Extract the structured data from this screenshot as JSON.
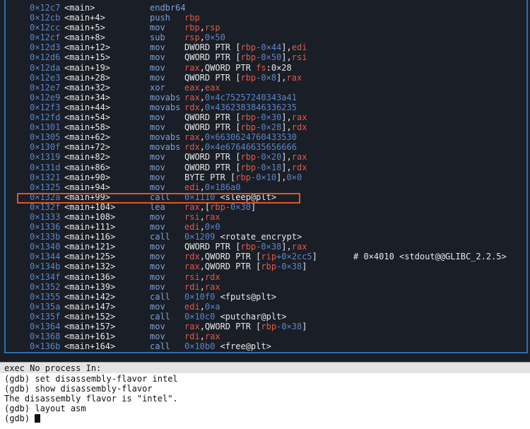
{
  "asm": {
    "rows": [
      {
        "addr": "0×12c7",
        "sym": "<main>",
        "mn": "endbr64",
        "ops": []
      },
      {
        "addr": "0×12cb",
        "sym": "<main+4>",
        "mn": "push",
        "ops": [
          {
            "t": "rbp",
            "k": "reg"
          }
        ]
      },
      {
        "addr": "0×12cc",
        "sym": "<main+5>",
        "mn": "mov",
        "ops": [
          {
            "t": "rbp",
            "k": "reg"
          },
          {
            "t": ",",
            "k": "txt"
          },
          {
            "t": "rsp",
            "k": "reg"
          }
        ]
      },
      {
        "addr": "0×12cf",
        "sym": "<main+8>",
        "mn": "sub",
        "ops": [
          {
            "t": "rsp",
            "k": "reg"
          },
          {
            "t": ",",
            "k": "txt"
          },
          {
            "t": "0×50",
            "k": "num"
          }
        ]
      },
      {
        "addr": "0×12d3",
        "sym": "<main+12>",
        "mn": "mov",
        "ops": [
          {
            "t": "DWORD PTR [",
            "k": "txt"
          },
          {
            "t": "rbp",
            "k": "reg"
          },
          {
            "t": "-0×44",
            "k": "num"
          },
          {
            "t": "],",
            "k": "txt"
          },
          {
            "t": "edi",
            "k": "reg"
          }
        ]
      },
      {
        "addr": "0×12d6",
        "sym": "<main+15>",
        "mn": "mov",
        "ops": [
          {
            "t": "QWORD PTR [",
            "k": "txt"
          },
          {
            "t": "rbp",
            "k": "reg"
          },
          {
            "t": "-0×50",
            "k": "num"
          },
          {
            "t": "],",
            "k": "txt"
          },
          {
            "t": "rsi",
            "k": "reg"
          }
        ]
      },
      {
        "addr": "0×12da",
        "sym": "<main+19>",
        "mn": "mov",
        "ops": [
          {
            "t": "rax",
            "k": "reg"
          },
          {
            "t": ",QWORD PTR ",
            "k": "txt"
          },
          {
            "t": "fs",
            "k": "reg"
          },
          {
            "t": ":0×28",
            "k": "txt"
          }
        ]
      },
      {
        "addr": "0×12e3",
        "sym": "<main+28>",
        "mn": "mov",
        "ops": [
          {
            "t": "QWORD PTR [",
            "k": "txt"
          },
          {
            "t": "rbp",
            "k": "reg"
          },
          {
            "t": "-0×8",
            "k": "num"
          },
          {
            "t": "],",
            "k": "txt"
          },
          {
            "t": "rax",
            "k": "reg"
          }
        ]
      },
      {
        "addr": "0×12e7",
        "sym": "<main+32>",
        "mn": "xor",
        "ops": [
          {
            "t": "eax",
            "k": "reg"
          },
          {
            "t": ",",
            "k": "txt"
          },
          {
            "t": "eax",
            "k": "reg"
          }
        ]
      },
      {
        "addr": "0×12e9",
        "sym": "<main+34>",
        "mn": "movabs",
        "ops": [
          {
            "t": "rax",
            "k": "reg"
          },
          {
            "t": ",",
            "k": "txt"
          },
          {
            "t": "0×4c75257240343a41",
            "k": "num"
          }
        ]
      },
      {
        "addr": "0×12f3",
        "sym": "<main+44>",
        "mn": "movabs",
        "ops": [
          {
            "t": "rdx",
            "k": "reg"
          },
          {
            "t": ",",
            "k": "txt"
          },
          {
            "t": "0×4362383846336235",
            "k": "num"
          }
        ]
      },
      {
        "addr": "0×12fd",
        "sym": "<main+54>",
        "mn": "mov",
        "ops": [
          {
            "t": "QWORD PTR [",
            "k": "txt"
          },
          {
            "t": "rbp",
            "k": "reg"
          },
          {
            "t": "-0×30",
            "k": "num"
          },
          {
            "t": "],",
            "k": "txt"
          },
          {
            "t": "rax",
            "k": "reg"
          }
        ]
      },
      {
        "addr": "0×1301",
        "sym": "<main+58>",
        "mn": "mov",
        "ops": [
          {
            "t": "QWORD PTR [",
            "k": "txt"
          },
          {
            "t": "rbp",
            "k": "reg"
          },
          {
            "t": "-0×28",
            "k": "num"
          },
          {
            "t": "],",
            "k": "txt"
          },
          {
            "t": "rdx",
            "k": "reg"
          }
        ]
      },
      {
        "addr": "0×1305",
        "sym": "<main+62>",
        "mn": "movabs",
        "ops": [
          {
            "t": "rax",
            "k": "reg"
          },
          {
            "t": ",",
            "k": "txt"
          },
          {
            "t": "0×6630624760433530",
            "k": "num"
          }
        ]
      },
      {
        "addr": "0×130f",
        "sym": "<main+72>",
        "mn": "movabs",
        "ops": [
          {
            "t": "rdx",
            "k": "reg"
          },
          {
            "t": ",",
            "k": "txt"
          },
          {
            "t": "0×4e67646635656666",
            "k": "num"
          }
        ]
      },
      {
        "addr": "0×1319",
        "sym": "<main+82>",
        "mn": "mov",
        "ops": [
          {
            "t": "QWORD PTR [",
            "k": "txt"
          },
          {
            "t": "rbp",
            "k": "reg"
          },
          {
            "t": "-0×20",
            "k": "num"
          },
          {
            "t": "],",
            "k": "txt"
          },
          {
            "t": "rax",
            "k": "reg"
          }
        ]
      },
      {
        "addr": "0×131d",
        "sym": "<main+86>",
        "mn": "mov",
        "ops": [
          {
            "t": "QWORD PTR [",
            "k": "txt"
          },
          {
            "t": "rbp",
            "k": "reg"
          },
          {
            "t": "-0×18",
            "k": "num"
          },
          {
            "t": "],",
            "k": "txt"
          },
          {
            "t": "rdx",
            "k": "reg"
          }
        ]
      },
      {
        "addr": "0×1321",
        "sym": "<main+90>",
        "mn": "mov",
        "ops": [
          {
            "t": "BYTE PTR [",
            "k": "txt"
          },
          {
            "t": "rbp",
            "k": "reg"
          },
          {
            "t": "-0×10",
            "k": "num"
          },
          {
            "t": "],",
            "k": "txt"
          },
          {
            "t": "0×0",
            "k": "num"
          }
        ]
      },
      {
        "addr": "0×1325",
        "sym": "<main+94>",
        "mn": "mov",
        "ops": [
          {
            "t": "edi",
            "k": "reg"
          },
          {
            "t": ",",
            "k": "txt"
          },
          {
            "t": "0×186a0",
            "k": "num"
          }
        ]
      },
      {
        "addr": "0×132a",
        "sym": "<main+99>",
        "mn": "call",
        "ops": [
          {
            "t": "0×1110 ",
            "k": "num"
          },
          {
            "t": "<sleep@plt>",
            "k": "txt"
          }
        ]
      },
      {
        "addr": "0×132f",
        "sym": "<main+104>",
        "mn": "lea",
        "ops": [
          {
            "t": "rax",
            "k": "reg"
          },
          {
            "t": ",[",
            "k": "txt"
          },
          {
            "t": "rbp",
            "k": "reg"
          },
          {
            "t": "-0×30",
            "k": "num"
          },
          {
            "t": "]",
            "k": "txt"
          }
        ]
      },
      {
        "addr": "0×1333",
        "sym": "<main+108>",
        "mn": "mov",
        "ops": [
          {
            "t": "rsi",
            "k": "reg"
          },
          {
            "t": ",",
            "k": "txt"
          },
          {
            "t": "rax",
            "k": "reg"
          }
        ]
      },
      {
        "addr": "0×1336",
        "sym": "<main+111>",
        "mn": "mov",
        "ops": [
          {
            "t": "edi",
            "k": "reg"
          },
          {
            "t": ",",
            "k": "txt"
          },
          {
            "t": "0×0",
            "k": "num"
          }
        ]
      },
      {
        "addr": "0×133b",
        "sym": "<main+116>",
        "mn": "call",
        "ops": [
          {
            "t": "0×1209 ",
            "k": "num"
          },
          {
            "t": "<rotate_encrypt>",
            "k": "txt"
          }
        ]
      },
      {
        "addr": "0×1340",
        "sym": "<main+121>",
        "mn": "mov",
        "ops": [
          {
            "t": "QWORD PTR [",
            "k": "txt"
          },
          {
            "t": "rbp",
            "k": "reg"
          },
          {
            "t": "-0×38",
            "k": "num"
          },
          {
            "t": "],",
            "k": "txt"
          },
          {
            "t": "rax",
            "k": "reg"
          }
        ]
      },
      {
        "addr": "0×1344",
        "sym": "<main+125>",
        "mn": "mov",
        "ops": [
          {
            "t": "rdx",
            "k": "reg"
          },
          {
            "t": ",QWORD PTR [",
            "k": "txt"
          },
          {
            "t": "rip",
            "k": "reg"
          },
          {
            "t": "+0×2cc5",
            "k": "num"
          },
          {
            "t": "]",
            "k": "txt"
          }
        ],
        "cmt": "# 0×4010 <stdout@@GLIBC_2.2.5>"
      },
      {
        "addr": "0×134b",
        "sym": "<main+132>",
        "mn": "mov",
        "ops": [
          {
            "t": "rax",
            "k": "reg"
          },
          {
            "t": ",QWORD PTR [",
            "k": "txt"
          },
          {
            "t": "rbp",
            "k": "reg"
          },
          {
            "t": "-0×38",
            "k": "num"
          },
          {
            "t": "]",
            "k": "txt"
          }
        ]
      },
      {
        "addr": "0×134f",
        "sym": "<main+136>",
        "mn": "mov",
        "ops": [
          {
            "t": "rsi",
            "k": "reg"
          },
          {
            "t": ",",
            "k": "txt"
          },
          {
            "t": "rdx",
            "k": "reg"
          }
        ]
      },
      {
        "addr": "0×1352",
        "sym": "<main+139>",
        "mn": "mov",
        "ops": [
          {
            "t": "rdi",
            "k": "reg"
          },
          {
            "t": ",",
            "k": "txt"
          },
          {
            "t": "rax",
            "k": "reg"
          }
        ]
      },
      {
        "addr": "0×1355",
        "sym": "<main+142>",
        "mn": "call",
        "ops": [
          {
            "t": "0×10f0 ",
            "k": "num"
          },
          {
            "t": "<fputs@plt>",
            "k": "txt"
          }
        ]
      },
      {
        "addr": "0×135a",
        "sym": "<main+147>",
        "mn": "mov",
        "ops": [
          {
            "t": "edi",
            "k": "reg"
          },
          {
            "t": ",",
            "k": "txt"
          },
          {
            "t": "0×a",
            "k": "num"
          }
        ]
      },
      {
        "addr": "0×135f",
        "sym": "<main+152>",
        "mn": "call",
        "ops": [
          {
            "t": "0×10c0 ",
            "k": "num"
          },
          {
            "t": "<putchar@plt>",
            "k": "txt"
          }
        ]
      },
      {
        "addr": "0×1364",
        "sym": "<main+157>",
        "mn": "mov",
        "ops": [
          {
            "t": "rax",
            "k": "reg"
          },
          {
            "t": ",QWORD PTR [",
            "k": "txt"
          },
          {
            "t": "rbp",
            "k": "reg"
          },
          {
            "t": "-0×38",
            "k": "num"
          },
          {
            "t": "]",
            "k": "txt"
          }
        ]
      },
      {
        "addr": "0×1368",
        "sym": "<main+161>",
        "mn": "mov",
        "ops": [
          {
            "t": "rdi",
            "k": "reg"
          },
          {
            "t": ",",
            "k": "txt"
          },
          {
            "t": "rax",
            "k": "reg"
          }
        ]
      },
      {
        "addr": "0×136b",
        "sym": "<main+164>",
        "mn": "call",
        "ops": [
          {
            "t": "0×10b0 ",
            "k": "num"
          },
          {
            "t": "<free@plt>",
            "k": "txt"
          }
        ]
      }
    ],
    "highlighted_addr": "0×132a",
    "colors": {
      "border": "#2f6fb2",
      "highlight_box": "#e0562a",
      "register": "#e05a4a",
      "immediate": "#5b86c7"
    }
  },
  "status_bar": {
    "text": "exec No process In:"
  },
  "console": {
    "lines": [
      "(gdb) set disassembly-flavor intel",
      "(gdb) show disassembly-flavor",
      "The disassembly flavor is \"intel\".",
      "(gdb) layout asm"
    ],
    "prompt": "(gdb) "
  }
}
